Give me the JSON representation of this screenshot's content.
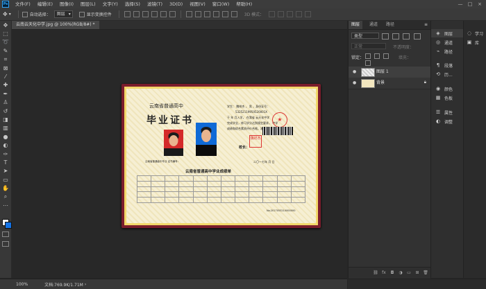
{
  "app": {
    "logo_text": "Ps"
  },
  "menubar": [
    "文件(F)",
    "编辑(E)",
    "图像(I)",
    "图层(L)",
    "文字(Y)",
    "选择(S)",
    "滤镜(T)",
    "3D(D)",
    "视图(V)",
    "窗口(W)",
    "帮助(H)"
  ],
  "window_controls": [
    "—",
    "□",
    "×"
  ],
  "options_bar": {
    "auto_select_label": "自动选择：",
    "auto_select_value": "图层",
    "show_transform_label": "显示变换控件",
    "mode_label": "3D 模式："
  },
  "document": {
    "tab_title": "云南云天化中学.jpg @ 100%(RGB/8#) *"
  },
  "certificate": {
    "province_line": "云南省普通高中",
    "main_title": "毕业证书",
    "student_line": "学生：  魏祥杰    ，  男  ，身份证号：",
    "id_number": "53252119950520001X",
    "body1": "于   年   月入学，  在我省    云天化中学",
    "body2": "完成学业，修习学分达到规定要求，    中学",
    "body3": "成绩和综合素质评价合格，准予毕业。",
    "principal": "校长：",
    "date": "二〇一七年   月   日",
    "serial": "云南省普通高中毕业   证书编号：",
    "seal_text": "★",
    "stamp_text": "魏祥杰",
    "table_title": "云南省普通高中学业成绩单",
    "cert_number": "No.2017053210000000"
  },
  "layers_panel": {
    "tabs": [
      "图层",
      "通道",
      "路径"
    ],
    "kind_filter": "类型",
    "blend_mode": "正常",
    "opacity_label": "不透明度：",
    "lock_label": "锁定：",
    "fill_label": "填充：",
    "layers": [
      {
        "name": "图层 1"
      },
      {
        "name": "背景"
      }
    ],
    "footer_icons": [
      "link-icon",
      "fx-icon",
      "mask-icon",
      "adjustment-icon",
      "group-icon",
      "new-layer-icon",
      "delete-icon"
    ]
  },
  "dock": {
    "items1": [
      {
        "icon": "layers-icon",
        "label": "图层"
      },
      {
        "icon": "channels-icon",
        "label": "通道"
      },
      {
        "icon": "paths-icon",
        "label": "路径"
      },
      {
        "icon": "paragraph-icon",
        "label": "段落"
      },
      {
        "icon": "history-icon",
        "label": "历..."
      },
      {
        "icon": "color-icon",
        "label": "颜色"
      },
      {
        "icon": "swatches-icon",
        "label": "色板"
      },
      {
        "icon": "properties-icon",
        "label": "属性"
      },
      {
        "icon": "adjustments-icon",
        "label": "调整"
      }
    ],
    "items2": [
      {
        "icon": "learn-icon",
        "label": "学习"
      },
      {
        "icon": "library-icon",
        "label": "库"
      }
    ]
  },
  "status": {
    "zoom": "100%",
    "doc_size": "文档:769.9K/1.71M"
  },
  "colors": {
    "foreground": "#ffffff",
    "background": "#1473e6"
  }
}
